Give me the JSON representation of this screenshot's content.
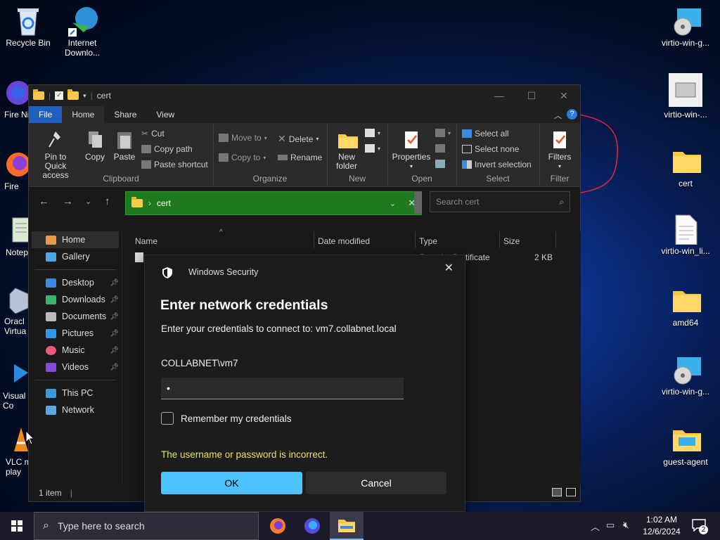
{
  "desktop": {
    "icons_left": [
      {
        "label": "Recycle Bin"
      },
      {
        "label": "Internet Downlo..."
      },
      {
        "label": "Fire Nigh"
      },
      {
        "label": "Fire"
      },
      {
        "label": "Notep"
      },
      {
        "label": "Oracl Virtua"
      },
      {
        "label": "Visual Co"
      },
      {
        "label": "VLC m play"
      }
    ],
    "icons_right": [
      {
        "label": "virtio-win-g..."
      },
      {
        "label": "virtio-win-..."
      },
      {
        "label": "cert"
      },
      {
        "label": "virtio-win_li..."
      },
      {
        "label": "amd64"
      },
      {
        "label": "virtio-win-g..."
      },
      {
        "label": "guest-agent"
      }
    ]
  },
  "explorer": {
    "title": "cert",
    "tabs": [
      "File",
      "Home",
      "Share",
      "View"
    ],
    "ribbon": {
      "clipboard": {
        "pin": "Pin to Quick access",
        "copy": "Copy",
        "paste": "Paste",
        "cut": "Cut",
        "copy_path": "Copy path",
        "paste_shortcut": "Paste shortcut",
        "label": "Clipboard"
      },
      "organize": {
        "move_to": "Move to",
        "copy_to": "Copy to",
        "delete": "Delete",
        "rename": "Rename",
        "label": "Organize"
      },
      "new": {
        "new_folder": "New folder",
        "label": "New"
      },
      "open": {
        "properties": "Properties",
        "label": "Open"
      },
      "select": {
        "select_all": "Select all",
        "select_none": "Select none",
        "invert": "Invert selection",
        "label": "Select"
      },
      "filter": {
        "filters": "Filters",
        "label": "Filter"
      }
    },
    "address": {
      "path": "cert"
    },
    "search": {
      "placeholder": "Search cert"
    },
    "nav": {
      "home": "Home",
      "gallery": "Gallery",
      "quick": [
        "Desktop",
        "Downloads",
        "Documents",
        "Pictures",
        "Music",
        "Videos"
      ],
      "this_pc": "This PC",
      "network": "Network"
    },
    "columns": {
      "name": "Name",
      "date": "Date modified",
      "type": "Type",
      "size": "Size"
    },
    "file_row": {
      "type": "Security Certificate",
      "size": "2 KB"
    },
    "status": "1 item"
  },
  "dialog": {
    "app": "Windows Security",
    "heading": "Enter network credentials",
    "message": "Enter your credentials to connect to: vm7.collabnet.local",
    "username": "COLLABNET\\vm7",
    "password_mask": "•",
    "remember": "Remember my credentials",
    "error": "The username or password is incorrect.",
    "ok": "OK",
    "cancel": "Cancel",
    "colors": {
      "ok": "#4cc2ff",
      "error": "#e8e35a"
    }
  },
  "taskbar": {
    "search_placeholder": "Type here to search",
    "time": "1:02 AM",
    "date": "12/6/2024",
    "notification_count": "2"
  }
}
